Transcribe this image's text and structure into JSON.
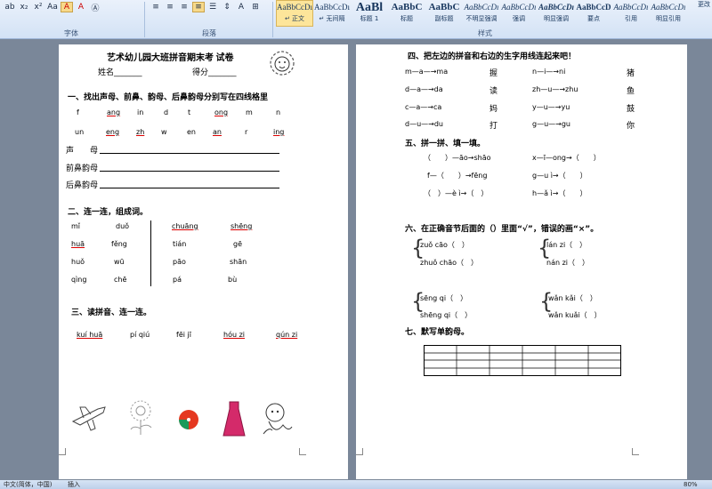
{
  "ribbon": {
    "font_group_label": "字体",
    "paragraph_group_label": "段落",
    "styles_group_label": "样式",
    "font_buttons": [
      "ab",
      "x₂",
      "x²",
      "Aa",
      "A",
      "A",
      "Ⓐ"
    ],
    "paragraph_buttons": [
      "≡",
      "≡",
      "≡",
      "≡",
      "☰",
      "⇕",
      "A",
      "⊞"
    ],
    "styles": [
      {
        "sample": "AaBbCcDı",
        "name": "↵ 正文"
      },
      {
        "sample": "AaBbCcDı",
        "name": "↵ 无间隔"
      },
      {
        "sample": "AaBl",
        "name": "标题 1"
      },
      {
        "sample": "AaBbC",
        "name": "标题"
      },
      {
        "sample": "AaBbC",
        "name": "副标题"
      },
      {
        "sample": "AaBbCcDı",
        "name": "不明显强调"
      },
      {
        "sample": "AaBbCcDı",
        "name": "强调"
      },
      {
        "sample": "AaBbCcDı",
        "name": "明显强调"
      },
      {
        "sample": "AaBbCcD",
        "name": "要点"
      },
      {
        "sample": "AaBbCcDı",
        "name": "引用"
      },
      {
        "sample": "AaBbCcDı",
        "name": "明显引用"
      }
    ],
    "change_styles_label": "更改"
  },
  "page1": {
    "title": "艺术幼儿园大班拼音期末考 试卷",
    "name_label": "姓名_______",
    "score_label": "得分_______",
    "section1_heading": "一、找出声母、前鼻、韵母、后鼻韵母分别写在四线格里",
    "section1_row1": [
      "f",
      "ang",
      "in",
      "d",
      "t",
      "ong",
      "m",
      "n"
    ],
    "section1_row2": [
      "un",
      "eng",
      "zh",
      "w",
      "en",
      "an",
      "r",
      "ing"
    ],
    "shengmu_label": "声　　母",
    "qianbi_label": "前鼻韵母",
    "houbi_label": "后鼻韵母",
    "section2_heading": "二、连一连，组成词。",
    "section2_left": [
      [
        "mǐ",
        "duǒ"
      ],
      [
        "huā",
        "fěng"
      ],
      [
        "huǒ",
        "wū"
      ],
      [
        "qìng",
        "chē"
      ]
    ],
    "section2_right": [
      [
        "chuāng",
        "shēng"
      ],
      [
        "tián",
        "gē"
      ],
      [
        "pāo",
        "shān"
      ],
      [
        "pá",
        "bù"
      ]
    ],
    "section3_heading": "三、读拼音、连一连。",
    "section3_words": [
      "kuí huā",
      "pí qiú",
      "fēi jī",
      "hóu zi",
      "qún zi"
    ]
  },
  "page2": {
    "section4_heading": "四、把左边的拼音和右边的生字用线连起来吧！",
    "section4_rows": [
      [
        "m—a—→ma",
        "握",
        "n—i—→ni",
        "猪"
      ],
      [
        "d—a—→da",
        "读",
        "zh—u—→zhu",
        "鱼"
      ],
      [
        "c—a—→ca",
        "妈",
        "y—u—→yu",
        "鼓"
      ],
      [
        "d—u—→du",
        "打",
        "g—u—→gu",
        "你"
      ]
    ],
    "section5_heading": "五、拼一拼、填一填。",
    "section5_rows": [
      [
        "（　　）—āo→shāo",
        "x—ī—ong→（　　）"
      ],
      [
        "f—（　　）→fēng",
        "g—u ì→（　　）"
      ],
      [
        "（　）—è ì→（　）",
        "h—ǎ ì→（　　）"
      ]
    ],
    "section6_heading": "六、在正确音节后面的（）里面“√”，错误的画“×”。",
    "section6_groups": [
      [
        "zuǒ cāo（　）",
        "zhuǒ chāo（　）"
      ],
      [
        "lán zi（　）",
        "nán zi（　）"
      ],
      [
        "sēng qi（　）",
        "shēng qi（　）"
      ],
      [
        "wǎn kǎi（　）",
        "wǎn kuǎi（　）"
      ]
    ],
    "section7_heading": "七、默写单韵母。"
  },
  "status": {
    "language": "中文(简体，中国)",
    "insert_mode": "插入",
    "zoom": "80%"
  }
}
